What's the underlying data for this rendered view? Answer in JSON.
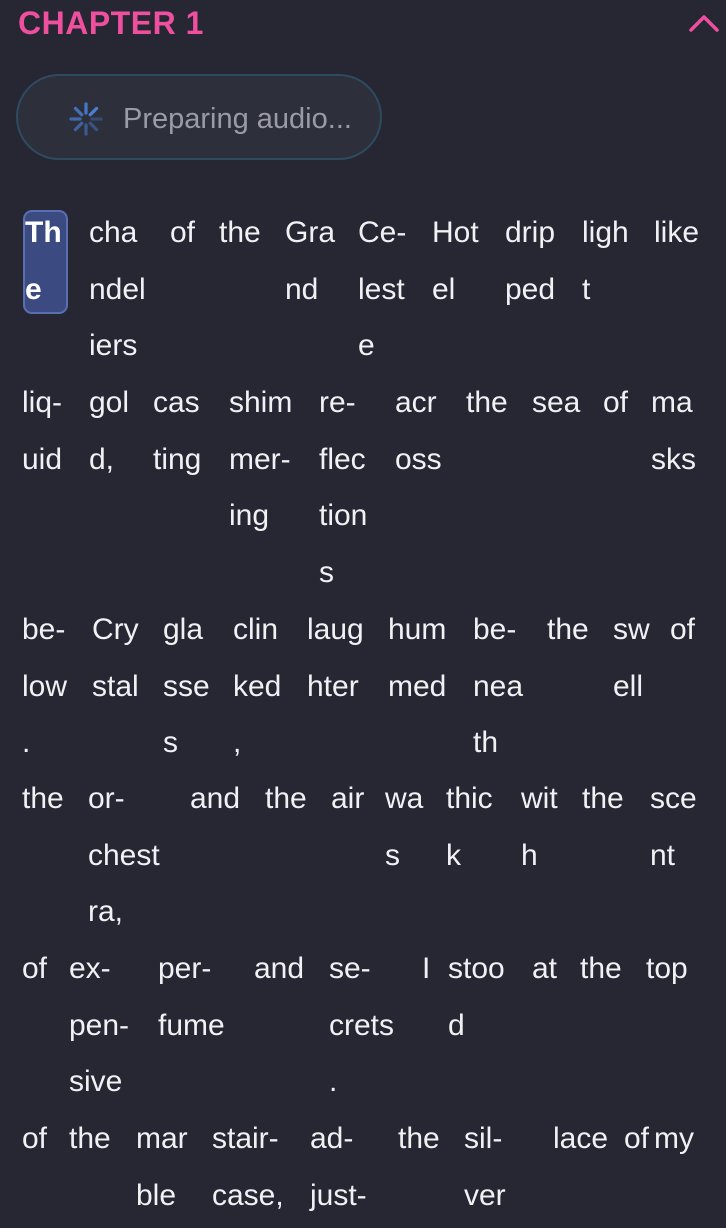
{
  "header": {
    "chapter_title": "CHAPTER 1"
  },
  "audio": {
    "status": "Preparing audio..."
  },
  "colors": {
    "background": "#262733",
    "chapter_title": "#ee4f9e",
    "highlight": "#3b4b82",
    "spinner": "#4a7fd6"
  },
  "icons": {
    "collapse": "chevron-up-icon",
    "loading": "spinner-icon"
  },
  "reader": {
    "lines": [
      [
        [
          "Th",
          "e"
        ],
        [
          "cha",
          "ndel",
          "iers"
        ],
        [
          "of"
        ],
        [
          "the"
        ],
        [
          "Gra",
          "nd"
        ],
        [
          "Ce-",
          "lest",
          "e"
        ],
        [
          "Hot",
          "el"
        ],
        [
          "drip",
          "ped"
        ],
        [
          "ligh",
          "t"
        ],
        [
          "like"
        ]
      ],
      [
        [
          "liq-",
          "uid"
        ],
        [
          "gol",
          "d,"
        ],
        [
          "cas",
          "ting"
        ],
        [
          "shim",
          "mer-",
          "ing"
        ],
        [
          "re-",
          "flec",
          "tion",
          "s"
        ],
        [
          "acr",
          "oss"
        ],
        [
          "the"
        ],
        [
          "sea"
        ],
        [
          "of"
        ],
        [
          "ma",
          "sks"
        ]
      ],
      [
        [
          "be-",
          "low",
          "."
        ],
        [
          "Cry",
          "stal"
        ],
        [
          "gla",
          "sse",
          "s"
        ],
        [
          "clin",
          "ked",
          ","
        ],
        [
          "laug",
          "hter"
        ],
        [
          "hum",
          "med"
        ],
        [
          "be-",
          "nea",
          "th"
        ],
        [
          "the"
        ],
        [
          "sw",
          "ell"
        ],
        [
          "of"
        ]
      ],
      [
        [
          "the"
        ],
        [
          "or-",
          "chest",
          "ra,"
        ],
        [
          "and"
        ],
        [
          "the"
        ],
        [
          "air"
        ],
        [
          "wa",
          "s"
        ],
        [
          "thic",
          "k"
        ],
        [
          "wit",
          "h"
        ],
        [
          "the"
        ],
        [
          "sce",
          "nt"
        ]
      ],
      [
        [
          "of"
        ],
        [
          "ex-",
          "pen-",
          "sive"
        ],
        [
          "per-",
          "fume"
        ],
        [
          "and"
        ],
        [
          "se-",
          "crets",
          "."
        ],
        [
          "I"
        ],
        [
          "stoo",
          "d"
        ],
        [
          "at"
        ],
        [
          "the"
        ],
        [
          "top"
        ]
      ],
      [
        [
          "of"
        ],
        [
          "the"
        ],
        [
          "mar",
          "ble"
        ],
        [
          "stair-",
          "case,"
        ],
        [
          "ad-",
          "just-"
        ],
        [
          "the"
        ],
        [
          "sil-",
          "ver"
        ],
        [
          "lace"
        ],
        [
          "of"
        ],
        [
          "my"
        ]
      ]
    ]
  }
}
